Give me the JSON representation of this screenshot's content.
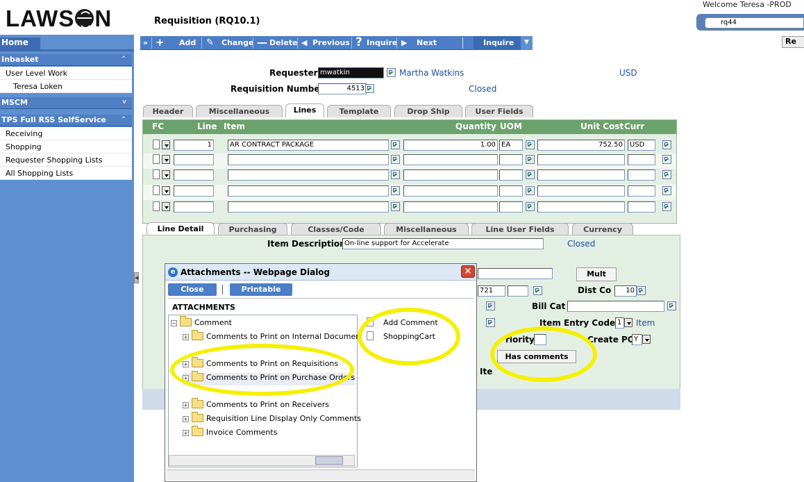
{
  "header": {
    "logo_text_left": "LAWS",
    "logo_text_right": "N",
    "form_title": "Requisition (RQ10.1)",
    "welcome": "Welcome Teresa -PROD",
    "form_id_value": "rq44",
    "re_button": "Re"
  },
  "nav": {
    "home": "Home",
    "sections": [
      {
        "label": "Inbasket",
        "items": [
          "User Level Work",
          "Teresa Loken"
        ]
      },
      {
        "label": "MSCM",
        "items": []
      },
      {
        "label": "TPS Full RSS SelfService",
        "items": [
          "Receiving",
          "Shopping",
          "Requester Shopping Lists",
          "All Shopping Lists"
        ]
      }
    ]
  },
  "toolbar": {
    "expand": "»",
    "add": "Add",
    "change": "Change",
    "delete": "Delete",
    "previous": "Previous",
    "inquire": "Inquire",
    "next": "Next",
    "inquire2": "Inquire"
  },
  "form": {
    "requester_label": "Requester",
    "requester_value": "mwatkin",
    "requester_name": "Martha Watkins",
    "currency": "USD",
    "req_number_label": "Requisition Number",
    "req_number_value": "4513",
    "status": "Closed"
  },
  "tabs_top": [
    "Header",
    "Miscellaneous",
    "Lines",
    "Template",
    "Drop Ship",
    "User Fields"
  ],
  "lines": {
    "headers": {
      "fc": "FC",
      "line": "Line",
      "item": "Item",
      "quantity": "Quantity",
      "uom": "UOM",
      "unit_cost": "Unit Cost",
      "curr": "Curr"
    },
    "rows": [
      {
        "line": "1",
        "item": "AR CONTRACT PACKAGE",
        "quantity": "1.00",
        "uom": "EA",
        "unit_cost": "752.50",
        "curr": "USD"
      },
      {
        "line": "",
        "item": "",
        "quantity": "",
        "uom": "",
        "unit_cost": "",
        "curr": ""
      },
      {
        "line": "",
        "item": "",
        "quantity": "",
        "uom": "",
        "unit_cost": "",
        "curr": ""
      },
      {
        "line": "",
        "item": "",
        "quantity": "",
        "uom": "",
        "unit_cost": "",
        "curr": ""
      },
      {
        "line": "",
        "item": "",
        "quantity": "",
        "uom": "",
        "unit_cost": "",
        "curr": ""
      }
    ]
  },
  "tabs_detail": [
    "Line Detail",
    "Purchasing",
    "Classes/Code",
    "Miscellaneous",
    "Line User Fields",
    "Currency"
  ],
  "detail": {
    "item_desc_label": "Item Description",
    "item_desc_value": "On-line support for Accelerate",
    "status": "Closed",
    "mult_button": "Mult",
    "partial_721": "721",
    "dist_co_label": "Dist Co",
    "dist_co_value": "10",
    "bill_cat_label": "Bill Cat",
    "item_entry_code_label": "Item Entry Code",
    "item_entry_code_value": "1",
    "item_link": "Item",
    "priority_partial": "riority",
    "create_po_label": "Create PO",
    "create_po_value": "Y",
    "has_comments_button": "Has comments",
    "ite_partial": "Ite"
  },
  "dialog": {
    "title": "Attachments -- Webpage Dialog",
    "close_button": "Close",
    "printable_button": "Printable View",
    "heading": "Attachments",
    "tree": [
      {
        "label": "Comment",
        "level": 0,
        "pm": "−"
      },
      {
        "label": "Comments to Print on Internal Documents",
        "level": 1,
        "pm": "+"
      },
      {
        "label": "Comments to Print on Requisitions",
        "level": 1,
        "pm": "+"
      },
      {
        "label": "Comments to Print on Purchase Orders",
        "level": 1,
        "pm": "+"
      },
      {
        "label": "Comments to Print on Receivers",
        "level": 1,
        "pm": "+"
      },
      {
        "label": "Requisition Line Display Only Comments",
        "level": 1,
        "pm": "+"
      },
      {
        "label": "Invoice Comments",
        "level": 1,
        "pm": "+"
      }
    ],
    "right_items": [
      "Add Comment",
      "ShoppingCart"
    ]
  },
  "colors": {
    "nav_blue": "#5e8fd0",
    "toolbar_blue": "#4b7ec6",
    "grid_green": "#6ca26c",
    "highlight_yellow": "#f4f000",
    "link_blue": "#1f4ea8"
  }
}
